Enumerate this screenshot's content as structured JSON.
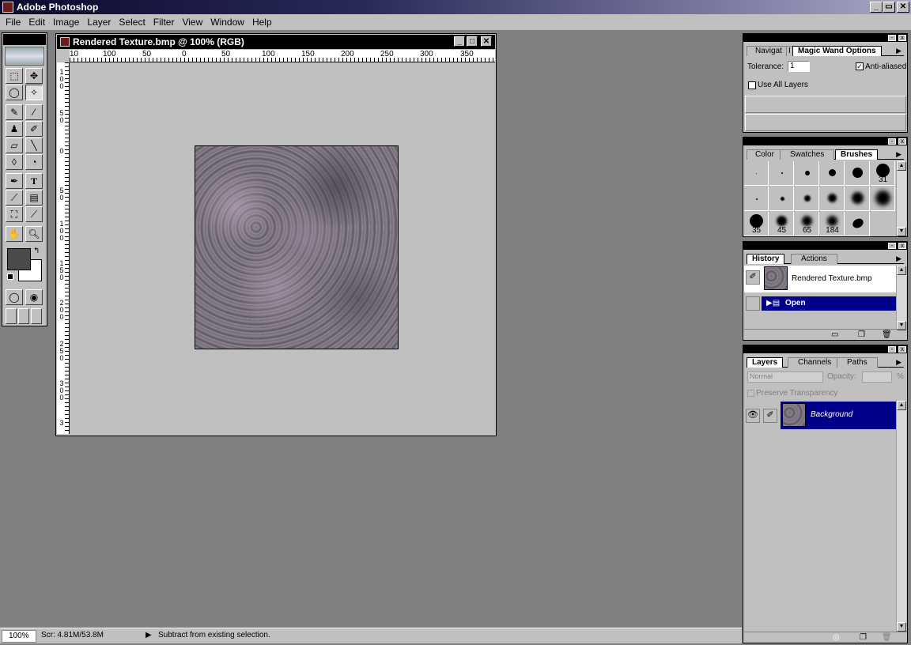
{
  "app": {
    "title": "Adobe Photoshop"
  },
  "menu": [
    "File",
    "Edit",
    "Image",
    "Layer",
    "Select",
    "Filter",
    "View",
    "Window",
    "Help"
  ],
  "document": {
    "title": "Rendered Texture.bmp @ 100% (RGB)",
    "ruler_top": [
      "10",
      "100",
      "50",
      "0",
      "50",
      "100",
      "150",
      "200",
      "250",
      "300",
      "350"
    ],
    "ruler_left": [
      "1\n0\n0",
      "5\n0",
      "0",
      "5\n0",
      "1\n0\n0",
      "1\n5\n0",
      "2\n0\n0",
      "2\n5\n0",
      "3\n0\n0",
      "3"
    ]
  },
  "magic_wand_panel": {
    "tabs": [
      "Navigat",
      "I",
      "Magic Wand Options"
    ],
    "tolerance_label": "Tolerance:",
    "tolerance_value": "1",
    "antialiased_label": "Anti-aliased",
    "antialiased_checked": true,
    "use_all_layers_label": "Use All Layers",
    "use_all_layers_checked": false
  },
  "brushes_panel": {
    "tabs": [
      "Color",
      "Swatches",
      "Brushes"
    ],
    "labels": [
      "31",
      "35",
      "45",
      "65",
      "184"
    ]
  },
  "history_panel": {
    "tabs": [
      "History",
      "Actions"
    ],
    "snapshot_label": "Rendered Texture.bmp",
    "states": [
      "Open"
    ]
  },
  "layers_panel": {
    "tabs": [
      "Layers",
      "Channels",
      "Paths"
    ],
    "blend_mode": "Normal",
    "opacity_label": "Opacity:",
    "opacity_unit": "%",
    "preserve_label": "Preserve Transparency",
    "layers": [
      "Background"
    ]
  },
  "status": {
    "zoom": "100%",
    "scratch": "Scr: 4.81M/53.8M",
    "message": "Subtract from existing selection."
  },
  "colors": {
    "title_dark": "#0a0a2e",
    "selection": "#00008b",
    "workspace": "#808080"
  }
}
